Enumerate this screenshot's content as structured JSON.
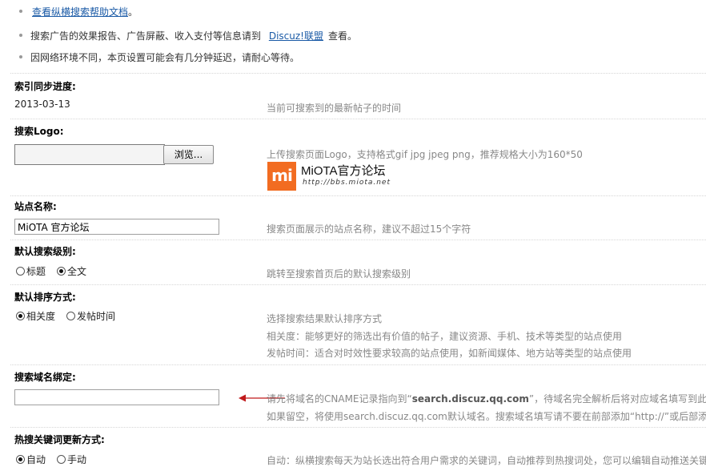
{
  "notices": [
    {
      "link_text": "查看纵横搜索帮助文档",
      "suffix": "。"
    },
    {
      "prefix": "搜索广告的效果报告、广告屏蔽、收入支付等信息请到",
      "link_text": "Discuz!联盟",
      "suffix": "查看。"
    },
    {
      "text": "因网络环境不同，本页设置可能会有几分钟延迟，请耐心等待。"
    }
  ],
  "sync": {
    "label": "索引同步进度:",
    "value": "2013-03-13",
    "tip": "当前可搜索到的最新帖子的时间"
  },
  "logo": {
    "label": "搜索Logo:",
    "file_value": "",
    "browse_label": "浏览...",
    "tip": "上传搜索页面Logo，支持格式gif jpg jpeg png，推荐规格大小为160*50",
    "preview_mark": "mi",
    "preview_name": "MiOTA官方论坛",
    "preview_url": "http://bbs.miota.net"
  },
  "site_name": {
    "label": "站点名称:",
    "value": "MiOTA 官方论坛",
    "tip": "搜索页面展示的站点名称，建议不超过15个字符"
  },
  "default_level": {
    "label": "默认搜索级别:",
    "options": [
      {
        "label": "标题",
        "checked": false
      },
      {
        "label": "全文",
        "checked": true
      }
    ],
    "tip": "跳转至搜索首页后的默认搜索级别"
  },
  "sort_mode": {
    "label": "默认排序方式:",
    "options": [
      {
        "label": "相关度",
        "checked": true
      },
      {
        "label": "发帖时间",
        "checked": false
      }
    ],
    "tips": [
      "选择搜索结果默认排序方式",
      "相关度：能够更好的筛选出有价值的帖子，建议资源、手机、技术等类型的站点使用",
      "发帖时间：适合对时效性要求较高的站点使用，如新闻媒体、地方站等类型的站点使用"
    ]
  },
  "domain_bind": {
    "label": "搜索域名绑定:",
    "value": "",
    "tip_pre": "请先将域名的CNAME记录指向到“",
    "tip_domain": "search.discuz.qq.com",
    "tip_post": "”，待域名完全解析后将对应域名填写到此",
    "tip2": "如果留空，将使用search.discuz.qq.com默认域名。搜索域名填写请不要在前部添加“http://”或后部添"
  },
  "hot_keywords": {
    "label": "热搜关键词更新方式:",
    "options": [
      {
        "label": "自动",
        "checked": true
      },
      {
        "label": "手动",
        "checked": false
      }
    ],
    "tip": "自动：纵横搜索每天为站长选出符合用户需求的关键词，自动推荐到热搜词处，您可以编辑自动推送关键"
  },
  "colors": {
    "link": "#1a5aa6",
    "label": "#000000",
    "tip": "#888888",
    "arrow": "#c0191b",
    "logo_orange": "#f26c21"
  }
}
